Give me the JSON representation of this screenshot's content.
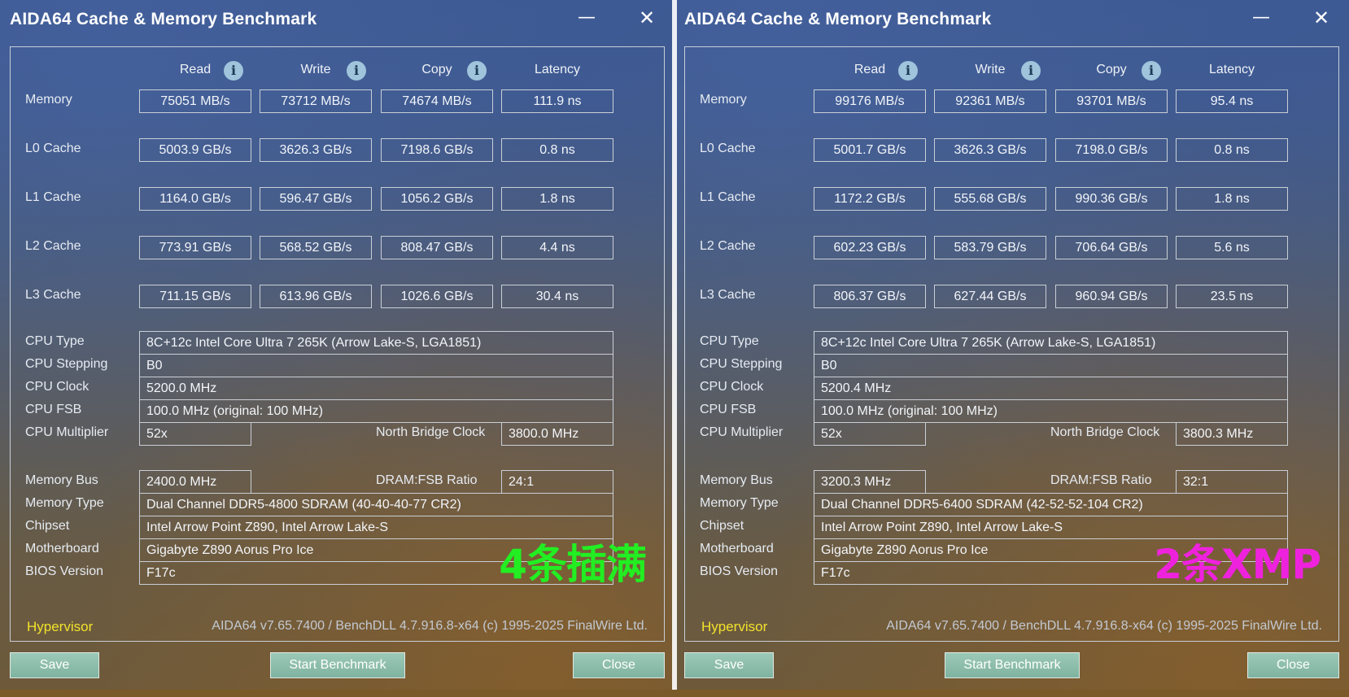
{
  "windows": [
    {
      "title": "AIDA64 Cache & Memory Benchmark",
      "minimize_glyph": "—",
      "close_glyph": "✕",
      "headers": {
        "read": "Read",
        "write": "Write",
        "copy": "Copy",
        "latency": "Latency"
      },
      "rows": [
        {
          "label": "Memory",
          "read": "75051 MB/s",
          "write": "73712 MB/s",
          "copy": "74674 MB/s",
          "latency": "111.9 ns"
        },
        {
          "label": "L0 Cache",
          "read": "5003.9 GB/s",
          "write": "3626.3 GB/s",
          "copy": "7198.6 GB/s",
          "latency": "0.8 ns"
        },
        {
          "label": "L1 Cache",
          "read": "1164.0 GB/s",
          "write": "596.47 GB/s",
          "copy": "1056.2 GB/s",
          "latency": "1.8 ns"
        },
        {
          "label": "L2 Cache",
          "read": "773.91 GB/s",
          "write": "568.52 GB/s",
          "copy": "808.47 GB/s",
          "latency": "4.4 ns"
        },
        {
          "label": "L3 Cache",
          "read": "711.15 GB/s",
          "write": "613.96 GB/s",
          "copy": "1026.6 GB/s",
          "latency": "30.4 ns"
        }
      ],
      "info": {
        "cpu_type_label": "CPU Type",
        "cpu_type": "8C+12c Intel Core Ultra 7 265K  (Arrow Lake-S, LGA1851)",
        "cpu_stepping_label": "CPU Stepping",
        "cpu_stepping": "B0",
        "cpu_clock_label": "CPU Clock",
        "cpu_clock": "5200.0 MHz",
        "cpu_fsb_label": "CPU FSB",
        "cpu_fsb": "100.0 MHz  (original: 100 MHz)",
        "cpu_multiplier_label": "CPU Multiplier",
        "cpu_multiplier": "52x",
        "nb_clock_label": "North Bridge Clock",
        "nb_clock": "3800.0 MHz",
        "memory_bus_label": "Memory Bus",
        "memory_bus": "2400.0 MHz",
        "dram_fsb_label": "DRAM:FSB Ratio",
        "dram_fsb": "24:1",
        "memory_type_label": "Memory Type",
        "memory_type": "Dual Channel DDR5-4800 SDRAM  (40-40-40-77 CR2)",
        "chipset_label": "Chipset",
        "chipset": "Intel Arrow Point Z890, Intel Arrow Lake-S",
        "motherboard_label": "Motherboard",
        "motherboard": "Gigabyte Z890 Aorus Pro Ice",
        "bios_label": "BIOS Version",
        "bios": "F17c"
      },
      "hypervisor": "Hypervisor",
      "version": "AIDA64 v7.65.7400 / BenchDLL 4.7.916.8-x64  (c) 1995-2025 FinalWire Ltd.",
      "overlay_text": "4条插满",
      "overlay_color": "#22ee22",
      "buttons": {
        "save": "Save",
        "start": "Start Benchmark",
        "close": "Close"
      }
    },
    {
      "title": "AIDA64 Cache & Memory Benchmark",
      "minimize_glyph": "—",
      "close_glyph": "✕",
      "headers": {
        "read": "Read",
        "write": "Write",
        "copy": "Copy",
        "latency": "Latency"
      },
      "rows": [
        {
          "label": "Memory",
          "read": "99176 MB/s",
          "write": "92361 MB/s",
          "copy": "93701 MB/s",
          "latency": "95.4 ns"
        },
        {
          "label": "L0 Cache",
          "read": "5001.7 GB/s",
          "write": "3626.3 GB/s",
          "copy": "7198.0 GB/s",
          "latency": "0.8 ns"
        },
        {
          "label": "L1 Cache",
          "read": "1172.2 GB/s",
          "write": "555.68 GB/s",
          "copy": "990.36 GB/s",
          "latency": "1.8 ns"
        },
        {
          "label": "L2 Cache",
          "read": "602.23 GB/s",
          "write": "583.79 GB/s",
          "copy": "706.64 GB/s",
          "latency": "5.6 ns"
        },
        {
          "label": "L3 Cache",
          "read": "806.37 GB/s",
          "write": "627.44 GB/s",
          "copy": "960.94 GB/s",
          "latency": "23.5 ns"
        }
      ],
      "info": {
        "cpu_type_label": "CPU Type",
        "cpu_type": "8C+12c Intel Core Ultra 7 265K  (Arrow Lake-S, LGA1851)",
        "cpu_stepping_label": "CPU Stepping",
        "cpu_stepping": "B0",
        "cpu_clock_label": "CPU Clock",
        "cpu_clock": "5200.4 MHz",
        "cpu_fsb_label": "CPU FSB",
        "cpu_fsb": "100.0 MHz  (original: 100 MHz)",
        "cpu_multiplier_label": "CPU Multiplier",
        "cpu_multiplier": "52x",
        "nb_clock_label": "North Bridge Clock",
        "nb_clock": "3800.3 MHz",
        "memory_bus_label": "Memory Bus",
        "memory_bus": "3200.3 MHz",
        "dram_fsb_label": "DRAM:FSB Ratio",
        "dram_fsb": "32:1",
        "memory_type_label": "Memory Type",
        "memory_type": "Dual Channel DDR5-6400 SDRAM  (42-52-52-104 CR2)",
        "chipset_label": "Chipset",
        "chipset": "Intel Arrow Point Z890, Intel Arrow Lake-S",
        "motherboard_label": "Motherboard",
        "motherboard": "Gigabyte Z890 Aorus Pro Ice",
        "bios_label": "BIOS Version",
        "bios": "F17c"
      },
      "hypervisor": "Hypervisor",
      "version": "AIDA64 v7.65.7400 / BenchDLL 4.7.916.8-x64  (c) 1995-2025 FinalWire Ltd.",
      "overlay_text": "2条XMP",
      "overlay_color": "#ee22dd",
      "buttons": {
        "save": "Save",
        "start": "Start Benchmark",
        "close": "Close"
      }
    }
  ]
}
